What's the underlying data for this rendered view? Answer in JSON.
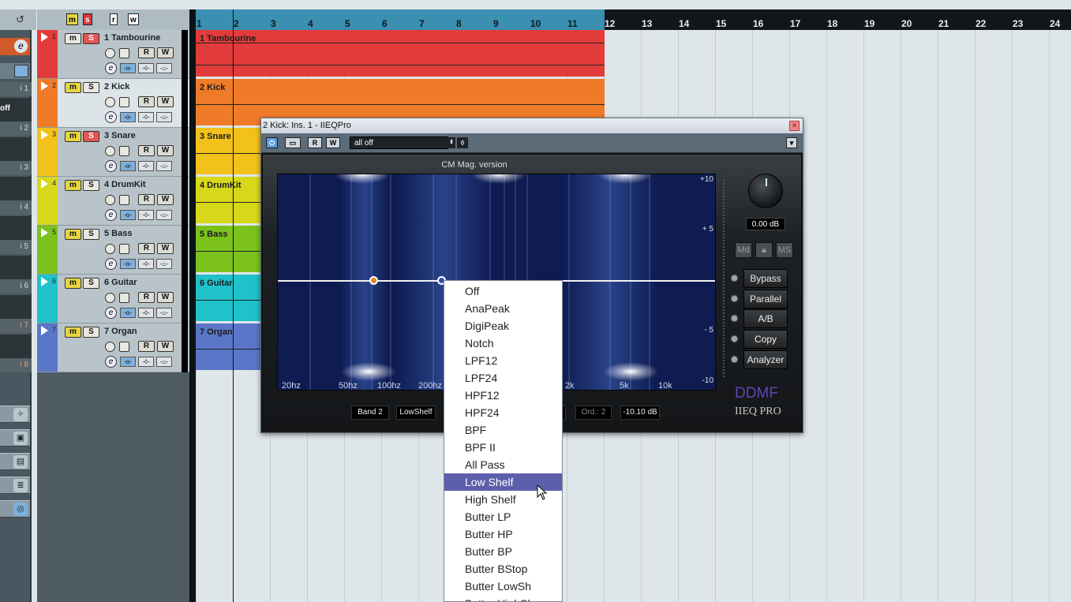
{
  "ruler": {
    "numbers": [
      "1",
      "2",
      "3",
      "4",
      "5",
      "6",
      "7",
      "8",
      "9",
      "10",
      "11",
      "12",
      "13",
      "14",
      "15",
      "16",
      "17",
      "18",
      "19",
      "20",
      "21",
      "22",
      "23",
      "24"
    ]
  },
  "tracklist": {
    "header": {
      "m": "m",
      "s": "s",
      "r": "r",
      "w": "w"
    }
  },
  "tracks": [
    {
      "num": "1",
      "name": "1 Tambourine",
      "color": "#e23b3b",
      "solo_on": true
    },
    {
      "num": "2",
      "name": "2 Kick",
      "color": "#ef7b28",
      "solo_on": false
    },
    {
      "num": "3",
      "name": "3 Snare",
      "color": "#f2c21b",
      "solo_on": true
    },
    {
      "num": "4",
      "name": "4 DrumKit",
      "color": "#d7d81a",
      "solo_on": false
    },
    {
      "num": "5",
      "name": "5 Bass",
      "color": "#7bc21d",
      "solo_on": false
    },
    {
      "num": "6",
      "name": "6 Guitar",
      "color": "#1fc2c8",
      "solo_on": false
    },
    {
      "num": "7",
      "name": "7 Organ",
      "color": "#5a76c8",
      "solo_on": false
    }
  ],
  "track_buttons": {
    "m": "m",
    "s": "S",
    "r": "R",
    "w": "W",
    "e": "e"
  },
  "events": [
    {
      "label": "1 Tambourine",
      "color": "#e23b3b"
    },
    {
      "label": "2 Kick",
      "color": "#ef7b28"
    },
    {
      "label": "3 Snare",
      "color": "#f2c21b"
    },
    {
      "label": "4 DrumKit",
      "color": "#d7d81a"
    },
    {
      "label": "5 Bass",
      "color": "#7bc21d"
    },
    {
      "label": "6 Guitar",
      "color": "#1fc2c8"
    },
    {
      "label": "7 Organ",
      "color": "#5a76c8"
    }
  ],
  "inspector": {
    "labels": [
      "i 1",
      "i 2",
      "i 3",
      "i 4",
      "i 5",
      "i 6",
      "i 7",
      "i 8"
    ],
    "off": "off"
  },
  "plugin": {
    "title": "2 Kick: Ins. 1 - IIEQPro",
    "preset": "all off",
    "tool": {
      "r": "R",
      "w": "W"
    },
    "version": "CM Mag. version",
    "db_labels": [
      "+10",
      "+ 5",
      "- 5",
      "-10"
    ],
    "freq_labels": [
      "20hz",
      "50hz",
      "100hz",
      "200hz",
      "2k",
      "5k",
      "10k"
    ],
    "gain": "0.00 dB",
    "mode_buttons": [
      "Md",
      "MS"
    ],
    "side_buttons": [
      "Bypass",
      "Parallel",
      "A/B",
      "Copy",
      "Analyzer"
    ],
    "bottom": {
      "band": "Band 2",
      "type": "LowShelf",
      "order": "Ord.: 2",
      "value": "-10.10 dB",
      "partial": "0"
    },
    "logo": "DDMF",
    "logo_sub": "IIEQ PRO"
  },
  "dropdown": {
    "items": [
      "Off",
      "AnaPeak",
      "DigiPeak",
      "Notch",
      "LPF12",
      "LPF24",
      "HPF12",
      "HPF24",
      "BPF",
      "BPF II",
      "All Pass",
      "Low Shelf",
      "High Shelf",
      "Butter LP",
      "Butter HP",
      "Butter BP",
      "Butter BStop",
      "Butter LowSh",
      "Butter HighSh"
    ],
    "selected": "Low Shelf"
  }
}
